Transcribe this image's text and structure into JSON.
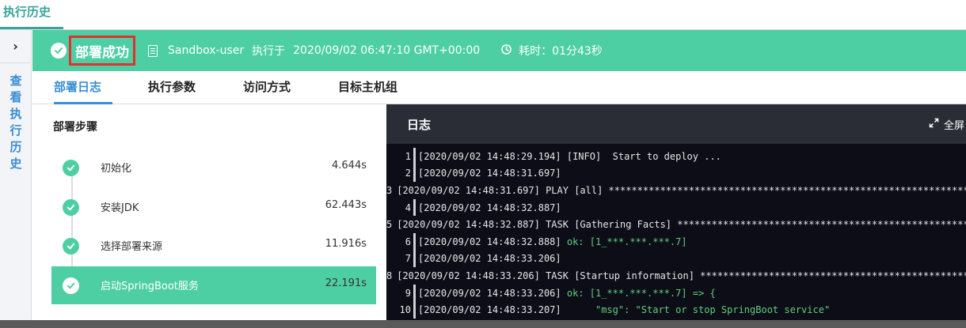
{
  "page": {
    "title": "执行历史"
  },
  "rail": {
    "toggle": "›",
    "label": "查看执行历史"
  },
  "status": {
    "result": "部署成功",
    "user": "Sandbox-user",
    "executed_label": "执行于",
    "executed_time": "2020/09/02 06:47:10 GMT+00:00",
    "duration_label": "耗时：",
    "duration_value": "01分43秒",
    "color": "#4ecfa3"
  },
  "tabs": [
    {
      "label": "部署日志"
    },
    {
      "label": "执行参数"
    },
    {
      "label": "访问方式"
    },
    {
      "label": "目标主机组"
    }
  ],
  "steps": {
    "title": "部署步骤",
    "items": [
      {
        "name": "初始化",
        "duration": "4.644s"
      },
      {
        "name": "安装JDK",
        "duration": "62.443s"
      },
      {
        "name": "选择部署来源",
        "duration": "11.916s"
      },
      {
        "name": "启动SpringBoot服务",
        "duration": "22.191s"
      }
    ]
  },
  "log": {
    "title": "日志",
    "fullscreen_label": "全屏",
    "lines": [
      {
        "n": "1",
        "t": "[2020/09/02 14:48:29.194] [INFO]  Start to deploy ..."
      },
      {
        "n": "2",
        "t": "[2020/09/02 14:48:31.697]"
      },
      {
        "n": "3",
        "t": "[2020/09/02 14:48:31.697] PLAY [all] ****************************************************************"
      },
      {
        "n": "4",
        "t": "[2020/09/02 14:48:32.887]"
      },
      {
        "n": "5",
        "t": "[2020/09/02 14:48:32.887] TASK [Gathering Facts] *****************************************************"
      },
      {
        "n": "6",
        "t": "[2020/09/02 14:48:32.888] ",
        "g": "ok: [1_***.***.***.7]"
      },
      {
        "n": "7",
        "t": "[2020/09/02 14:48:33.206]"
      },
      {
        "n": "8",
        "t": "[2020/09/02 14:48:33.206] TASK [Startup information] *************************************************"
      },
      {
        "n": "9",
        "t": "[2020/09/02 14:48:33.206] ",
        "g": "ok: [1_***.***.***.7] => {"
      },
      {
        "n": "10",
        "t": "[2020/09/02 14:48:33.207] ",
        "g": "     \"msg\": \"Start or stop SpringBoot service\""
      }
    ]
  }
}
